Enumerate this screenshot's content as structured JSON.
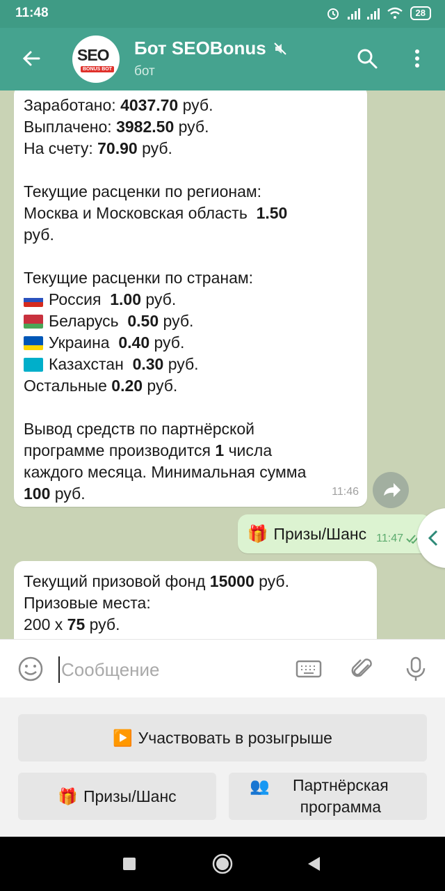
{
  "status_bar": {
    "time": "11:48",
    "battery": "28"
  },
  "header": {
    "title": "Бот SEOBonus",
    "subtitle": "бот",
    "avatar_text": "SEO",
    "avatar_tag": "BONUS BOT"
  },
  "messages": {
    "first": {
      "lines": [
        {
          "pre": "Заработано: ",
          "bold": "4037.70",
          "post": " руб."
        },
        {
          "pre": "Выплачено: ",
          "bold": "3982.50",
          "post": " руб."
        },
        {
          "pre": "На счету: ",
          "bold": "70.90",
          "post": " руб."
        },
        {
          "pre": "",
          "bold": "",
          "post": ""
        },
        {
          "pre": "Текущие расценки по регионам:",
          "bold": "",
          "post": ""
        },
        {
          "pre": "Москва и Московская область  ",
          "bold": "1.50",
          "post": ""
        },
        {
          "pre": "руб.",
          "bold": "",
          "post": ""
        },
        {
          "pre": "",
          "bold": "",
          "post": ""
        },
        {
          "pre": "Текущие расценки по странам:",
          "bold": "",
          "post": ""
        }
      ],
      "countries": [
        {
          "name": "Россия  ",
          "bold": "1.00",
          "post": " руб.",
          "flag": [
            "#ffffff",
            "#2a52be",
            "#d52b1e"
          ]
        },
        {
          "name": "Беларусь  ",
          "bold": "0.50",
          "post": " руб.",
          "flag": [
            "#c8313e",
            "#c8313e",
            "#4aa657"
          ]
        },
        {
          "name": "Украина  ",
          "bold": "0.40",
          "post": " руб.",
          "flag": [
            "#0057b7",
            "#0057b7",
            "#ffd700"
          ]
        },
        {
          "name": "Казахстан  ",
          "bold": "0.30",
          "post": " руб.",
          "flag": [
            "#00afca",
            "#00afca",
            "#00afca"
          ]
        }
      ],
      "tail": [
        {
          "pre": "Остальные ",
          "bold": "0.20",
          "post": " руб."
        },
        {
          "pre": "",
          "bold": "",
          "post": ""
        },
        {
          "pre": "Вывод средств по партнёрской",
          "bold": "",
          "post": ""
        },
        {
          "pre": "программе производится ",
          "bold": "1",
          "post": " числа"
        },
        {
          "pre": "каждого месяца. Минимальная сумма",
          "bold": "",
          "post": ""
        },
        {
          "pre": "",
          "bold": "100",
          "post": " руб."
        }
      ],
      "time": "11:46"
    },
    "outgoing": {
      "emoji": "🎁",
      "text": "Призы/Шанс",
      "time": "11:47"
    },
    "second": {
      "lines": [
        {
          "pre": "Текущий призовой фонд ",
          "bold": "15000",
          "post": " руб."
        },
        {
          "pre": "Призовые места:",
          "bold": "",
          "post": ""
        },
        {
          "pre": "200 x ",
          "bold": "75",
          "post": " руб."
        }
      ]
    }
  },
  "input": {
    "placeholder": "Сообщение"
  },
  "keyboard": {
    "participate": {
      "emoji": "▶️",
      "label": "Участвовать в розыгрыше"
    },
    "prizes": {
      "emoji": "🎁",
      "label": "Призы/Шанс"
    },
    "partner": {
      "emoji": "👥",
      "label": "Партнёрская программа"
    }
  },
  "colors": {
    "header": "#45a38f",
    "status": "#3f9b85",
    "outgoing": "#dcf3d1",
    "chat_bg": "#c9d3b5"
  }
}
